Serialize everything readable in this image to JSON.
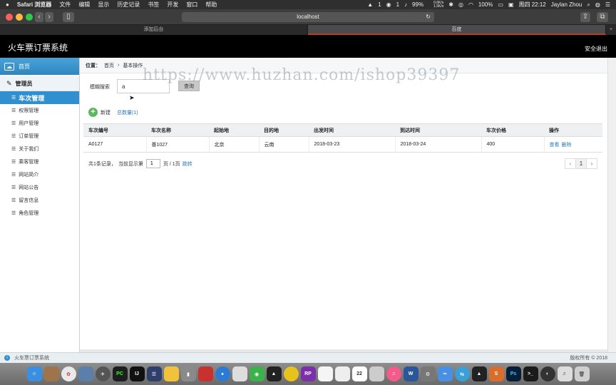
{
  "menubar": {
    "apple": "",
    "app": "Safari 浏览器",
    "menus": [
      "文件",
      "编辑",
      "显示",
      "历史记录",
      "书签",
      "开发",
      "窗口",
      "帮助"
    ],
    "status": {
      "qq_count": "1",
      "wechat_count": "1",
      "battery": "99%",
      "net_up": "0.6K/s",
      "net_down": "1.5K/s",
      "battery2": "100%",
      "datetime": "周四 22:12",
      "user": "Jaylan Zhou"
    }
  },
  "browser": {
    "url": "localhost",
    "tabs": [
      {
        "label": "添加后台",
        "active": false
      },
      {
        "label": "百度",
        "active": true
      }
    ]
  },
  "header": {
    "title": "火车票订票系统",
    "logout": "安全退出"
  },
  "sidebar": {
    "home": "首页",
    "admin": "管理员",
    "items": [
      {
        "label": "车次管理",
        "active": true
      },
      {
        "label": "权限管理"
      },
      {
        "label": "用户管理"
      },
      {
        "label": "订单管理"
      },
      {
        "label": "关于我们"
      },
      {
        "label": "乘客管理"
      },
      {
        "label": "网站简介"
      },
      {
        "label": "网站公告"
      },
      {
        "label": "留言信息"
      },
      {
        "label": "角色管理"
      }
    ]
  },
  "breadcrumb": {
    "prefix": "位置：",
    "home": "首页",
    "sep": "›",
    "current": "基本操作"
  },
  "search": {
    "label": "模糊搜索",
    "value": "a",
    "button": "查询"
  },
  "actions": {
    "add": "新建",
    "total": "总数量(1)"
  },
  "table": {
    "headers": [
      "车次编号",
      "车次名称",
      "起始地",
      "目的地",
      "出发时间",
      "到达时间",
      "车次价格",
      "操作"
    ],
    "rows": [
      {
        "code": "A0127",
        "name": "普1027",
        "from": "北京",
        "to": "云南",
        "depart": "2018-03-23",
        "arrive": "2018-03-24",
        "price": "400",
        "view": "查看",
        "delete": "删除"
      }
    ]
  },
  "pagination": {
    "records": "共1条记录，",
    "current_prefix": "当前显示第",
    "page_value": "1",
    "suffix": "页 / 1页",
    "jump": "跳转",
    "prev": "‹",
    "page": "1",
    "next": "›"
  },
  "watermark": "https://www.huzhan.com/ishop39397",
  "footer": {
    "left": "火车票订票系统",
    "right": "版权所有 © 2018"
  },
  "colors": {
    "accent": "#2f8fcf",
    "header": "#000000",
    "add": "#5cb85c"
  }
}
